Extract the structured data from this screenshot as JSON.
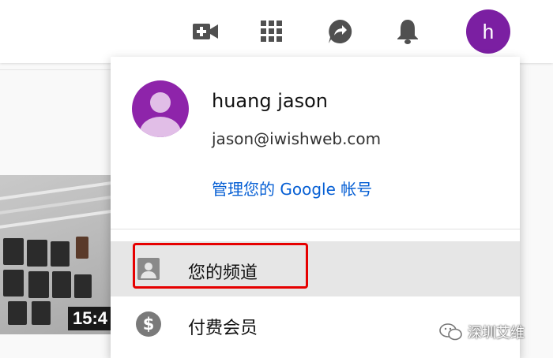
{
  "header": {
    "icons": [
      "video-camera-icon",
      "apps-grid-icon",
      "share-icon",
      "bell-icon"
    ],
    "avatar_letter": "h"
  },
  "video": {
    "duration": "15:4"
  },
  "account_menu": {
    "user_name": "huang jason",
    "email": "jason@iwishweb.com",
    "manage_account_label": "管理您的 Google 帐号",
    "items": [
      {
        "label": "您的频道",
        "icon": "person-icon",
        "active": true
      },
      {
        "label": "付费会员",
        "icon": "dollar-icon",
        "active": false
      }
    ]
  },
  "watermark": {
    "text": "深圳艾维"
  },
  "colors": {
    "avatar": "#7b1fa2",
    "link": "#065fd4",
    "highlight": "#e60000",
    "icon_gray": "#606060"
  }
}
